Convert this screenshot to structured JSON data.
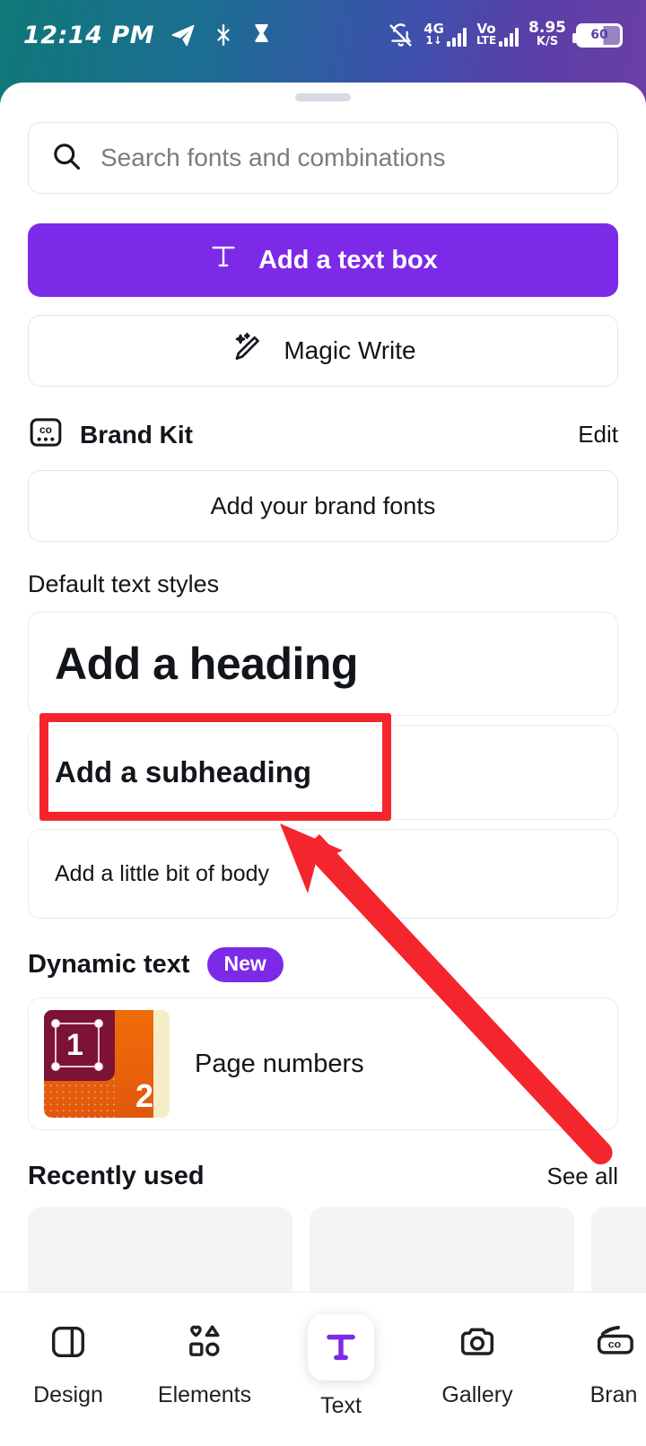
{
  "status_bar": {
    "time": "12:14 PM",
    "icons_left": [
      "telegram-icon",
      "bluetooth-off-icon",
      "hourglass-icon"
    ],
    "mute_icon": "bell-off-icon",
    "network_1": {
      "label_top": "4G",
      "label_bottom": "1↓"
    },
    "network_2": {
      "label_top": "Vo",
      "label_bottom": "LTE"
    },
    "data_rate": {
      "value": "8.95",
      "unit": "K/S"
    },
    "battery": "60"
  },
  "sheet": {
    "search": {
      "placeholder": "Search fonts and combinations",
      "value": "",
      "icon": "search-icon"
    },
    "add_text_box": {
      "label": "Add a text box",
      "icon": "text-T-icon",
      "color": "#7d2ae8"
    },
    "magic_write": {
      "label": "Magic Write",
      "icon": "magic-pencil-icon"
    },
    "brand_kit": {
      "title": "Brand Kit",
      "icon": "canva-brand-icon",
      "edit_label": "Edit",
      "add_fonts_label": "Add your brand fonts"
    },
    "default_text_styles": {
      "label": "Default text styles",
      "items": [
        {
          "label": "Add a heading",
          "style": "heading"
        },
        {
          "label": "Add a subheading",
          "style": "subheading"
        },
        {
          "label": "Add a little bit of body",
          "style": "body"
        }
      ]
    },
    "dynamic_text": {
      "label": "Dynamic text",
      "badge": "New",
      "badge_color": "#7d2ae8",
      "items": [
        {
          "label": "Page numbers",
          "thumb_num_1": "1",
          "thumb_num_2": "2"
        }
      ]
    },
    "recently_used": {
      "label": "Recently used",
      "see_all_label": "See all",
      "tiles": [
        295,
        295,
        295
      ]
    }
  },
  "bottom_nav": {
    "items": [
      {
        "label": "Design",
        "icon": "layout-panel-icon",
        "active": false
      },
      {
        "label": "Elements",
        "icon": "shapes-icon",
        "active": false
      },
      {
        "label": "Text",
        "icon": "text-T-icon",
        "active": true
      },
      {
        "label": "Gallery",
        "icon": "camera-icon",
        "active": false
      },
      {
        "label": "Bran",
        "icon": "canva-brand-icon",
        "active": false
      }
    ]
  },
  "annotations": {
    "highlight_box": {
      "color": "#f5252d",
      "target": "Add a subheading"
    },
    "arrow": {
      "color": "#f5252d",
      "points_to": "Add a subheading"
    }
  }
}
